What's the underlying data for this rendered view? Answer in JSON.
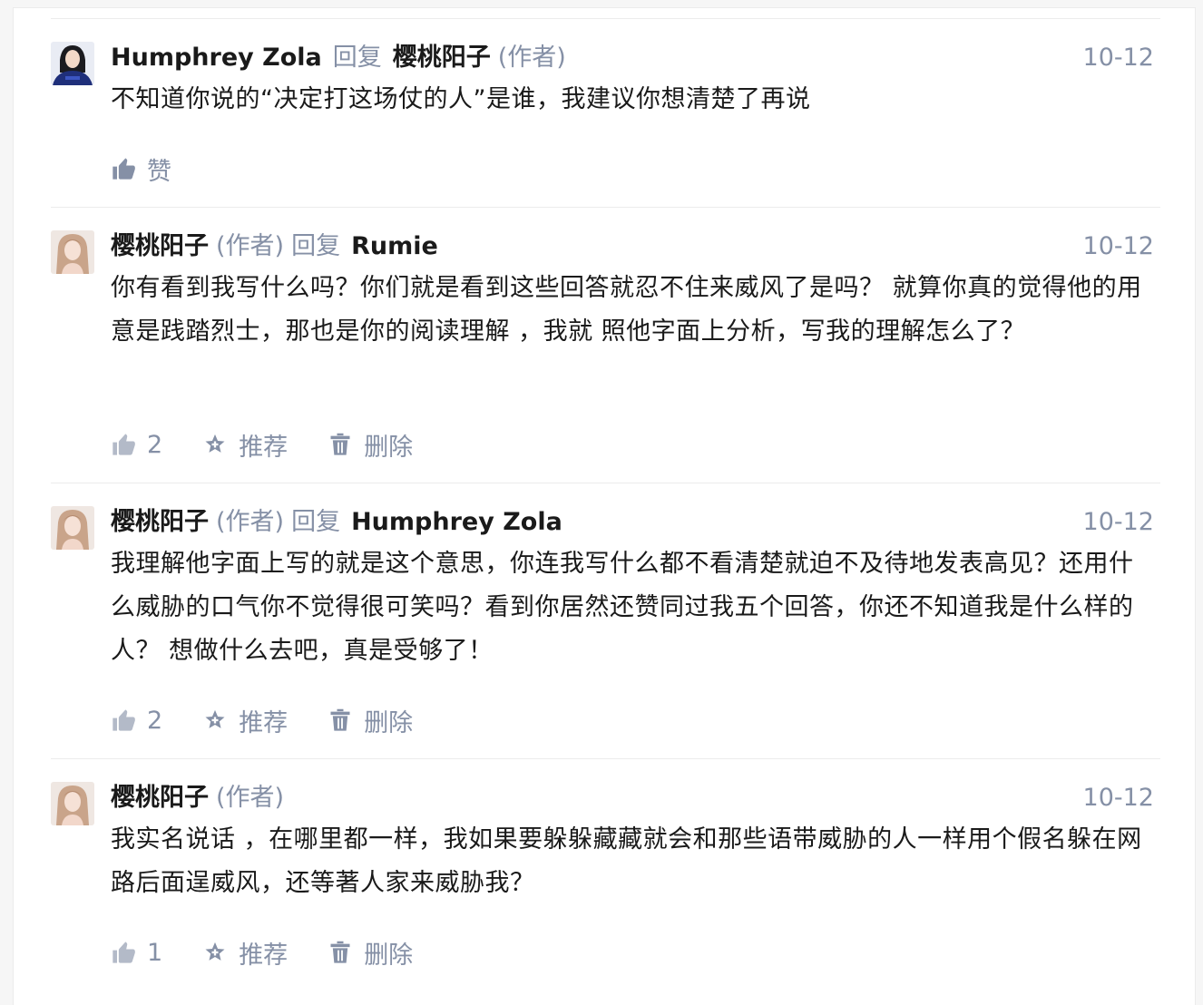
{
  "labels": {
    "reply": "回复",
    "author_tag": "(作者)",
    "like": "赞",
    "recommend": "推荐",
    "delete": "删除"
  },
  "comments": [
    {
      "author": "Humphrey Zola",
      "reply_to": "樱桃阳子",
      "date": "10-12",
      "text": "不知道你说的“决定打这场仗的人”是谁，我建议你想清楚了再说"
    },
    {
      "author": "樱桃阳子",
      "reply_to": "Rumie",
      "date": "10-12",
      "text": "你有看到我写什么吗？你们就是看到这些回答就忍不住来威风了是吗？ 就算你真的觉得他的用意是践踏烈士，那也是你的阅读理解 ，我就 照他字面上分析，写我的理解怎么了？",
      "likes": "2"
    },
    {
      "author": "樱桃阳子",
      "reply_to": "Humphrey Zola",
      "date": "10-12",
      "text": "我理解他字面上写的就是这个意思，你连我写什么都不看清楚就迫不及待地发表高见？还用什么威胁的口气你不觉得很可笑吗？看到你居然还赞同过我五个回答，你还不知道我是什么样的人？ 想做什么去吧，真是受够了！",
      "likes": "2"
    },
    {
      "author": "樱桃阳子",
      "date": "10-12",
      "text": "我实名说话 ，在哪里都一样，我如果要躲躲藏藏就会和那些语带威胁的人一样用个假名躲在网路后面逞威风，还等著人家来威胁我？",
      "likes": "1"
    }
  ]
}
